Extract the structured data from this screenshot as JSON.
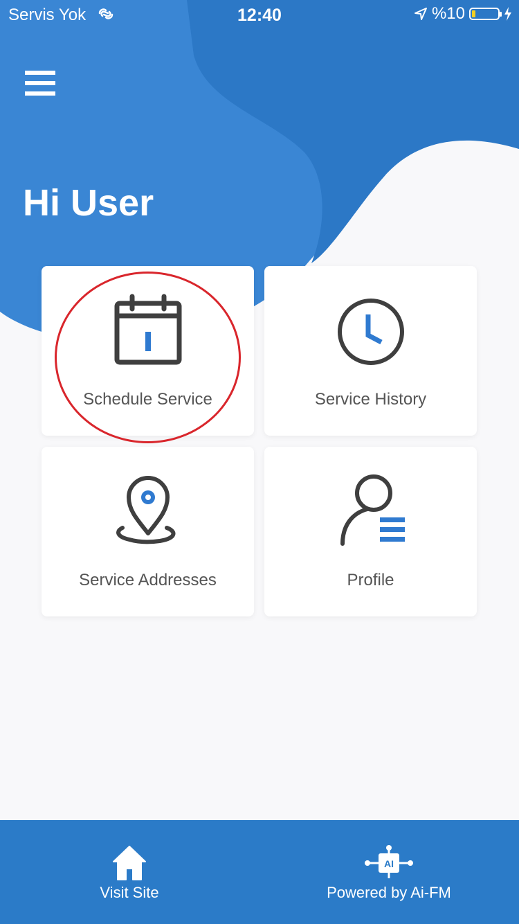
{
  "status_bar": {
    "carrier": "Servis Yok",
    "time": "12:40",
    "battery": "%10"
  },
  "greeting": "Hi User",
  "cards": {
    "schedule": {
      "label": "Schedule Service",
      "icon": "calendar-icon"
    },
    "history": {
      "label": "Service History",
      "icon": "clock-icon"
    },
    "addresses": {
      "label": "Service Addresses",
      "icon": "location-pin-icon"
    },
    "profile": {
      "label": "Profile",
      "icon": "profile-icon"
    }
  },
  "bottom_bar": {
    "visit_site": "Visit Site",
    "powered_by": "Powered by Ai-FM",
    "ai_badge": "AI"
  },
  "colors": {
    "primary": "#2b7bc8",
    "primary_light": "#3a86d4",
    "icon_dark": "#3f3f3f",
    "accent_blue": "#2f7ad0",
    "highlight_red": "#d9262c",
    "background": "#f8f8fa"
  }
}
